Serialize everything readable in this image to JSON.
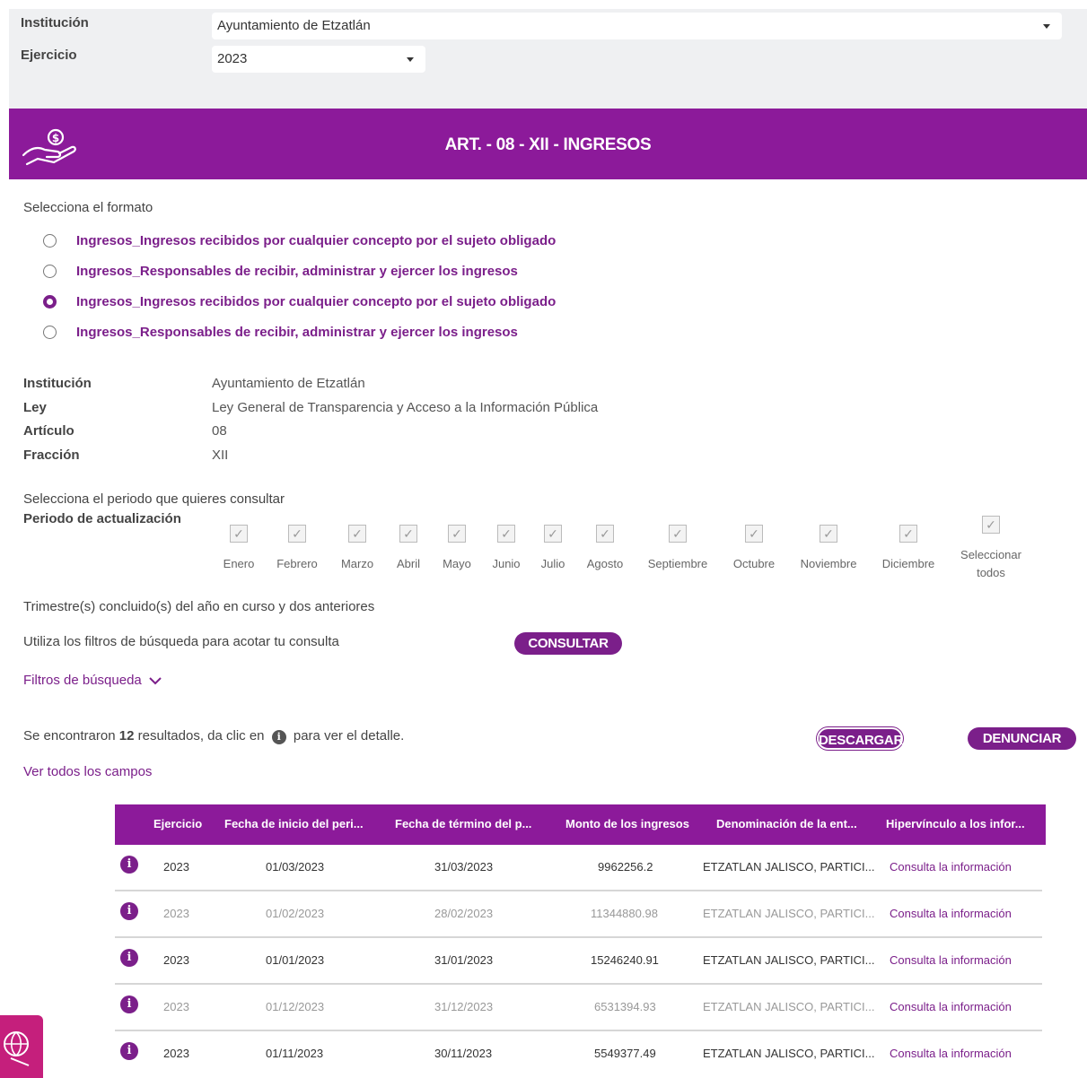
{
  "filters": {
    "institucion_label": "Institución",
    "institucion_value": "Ayuntamiento de Etzatlán",
    "ejercicio_label": "Ejercicio",
    "ejercicio_value": "2023"
  },
  "banner": {
    "title": "ART. - 08 - XII - INGRESOS",
    "icon": "hand-coin-icon"
  },
  "formato": {
    "prompt": "Selecciona el formato",
    "options": [
      {
        "label": "Ingresos_Ingresos recibidos por cualquier concepto por el sujeto obligado",
        "selected": false
      },
      {
        "label": "Ingresos_Responsables de recibir, administrar y ejercer los ingresos",
        "selected": false
      },
      {
        "label": "Ingresos_Ingresos recibidos por cualquier concepto por el sujeto obligado",
        "selected": true
      },
      {
        "label": "Ingresos_Responsables de recibir, administrar y ejercer los ingresos",
        "selected": false
      }
    ]
  },
  "info": {
    "institucion_label": "Institución",
    "institucion_value": "Ayuntamiento de Etzatlán",
    "ley_label": "Ley",
    "ley_value": "Ley General de Transparencia y Acceso a la Información Pública",
    "articulo_label": "Artículo",
    "articulo_value": "08",
    "fraccion_label": "Fracción",
    "fraccion_value": "XII"
  },
  "periodo": {
    "prompt": "Selecciona el periodo que quieres consultar",
    "label": "Periodo de actualización",
    "months": [
      "Enero",
      "Febrero",
      "Marzo",
      "Abril",
      "Mayo",
      "Junio",
      "Julio",
      "Agosto",
      "Septiembre",
      "Octubre",
      "Noviembre",
      "Diciembre"
    ],
    "select_all_1": "Seleccionar",
    "select_all_2": "todos",
    "check_mark": "✓",
    "note": "Trimestre(s) concluido(s) del año en curso y dos anteriores"
  },
  "search": {
    "hint": "Utiliza los filtros de búsqueda para acotar tu consulta",
    "consultar": "CONSULTAR",
    "filtros": "Filtros de búsqueda"
  },
  "results": {
    "text_pre": "Se encontraron",
    "count": "12",
    "text_mid": "resultados, da clic en",
    "text_post": "para ver el detalle.",
    "descargar": "DESCARGAR",
    "denunciar": "DENUNCIAR",
    "ver_todos": "Ver todos los campos"
  },
  "table": {
    "headers": [
      "Ejercicio",
      "Fecha de inicio del peri...",
      "Fecha de término del p...",
      "Monto de los ingresos",
      "Denominación de la ent...",
      "Hipervínculo a los infor..."
    ],
    "info_glyph": "i",
    "rows": [
      {
        "ejercicio": "2023",
        "inicio": "01/03/2023",
        "termino": "31/03/2023",
        "monto": "9962256.2",
        "denominacion": "ETZATLAN JALISCO, PARTICI...",
        "link": "Consulta la información",
        "style": "dark"
      },
      {
        "ejercicio": "2023",
        "inicio": "01/02/2023",
        "termino": "28/02/2023",
        "monto": "11344880.98",
        "denominacion": "ETZATLAN JALISCO, PARTICI...",
        "link": "Consulta la información",
        "style": "light"
      },
      {
        "ejercicio": "2023",
        "inicio": "01/01/2023",
        "termino": "31/01/2023",
        "monto": "15246240.91",
        "denominacion": "ETZATLAN JALISCO, PARTICI...",
        "link": "Consulta la información",
        "style": "dark"
      },
      {
        "ejercicio": "2023",
        "inicio": "01/12/2023",
        "termino": "31/12/2023",
        "monto": "6531394.93",
        "denominacion": "ETZATLAN JALISCO, PARTICI...",
        "link": "Consulta la información",
        "style": "light"
      },
      {
        "ejercicio": "2023",
        "inicio": "01/11/2023",
        "termino": "30/11/2023",
        "monto": "5549377.49",
        "denominacion": "ETZATLAN JALISCO, PARTICI...",
        "link": "Consulta la información",
        "style": "dark"
      }
    ]
  },
  "colors": {
    "primary": "#8c1a9a",
    "accent": "#c51f7c"
  }
}
